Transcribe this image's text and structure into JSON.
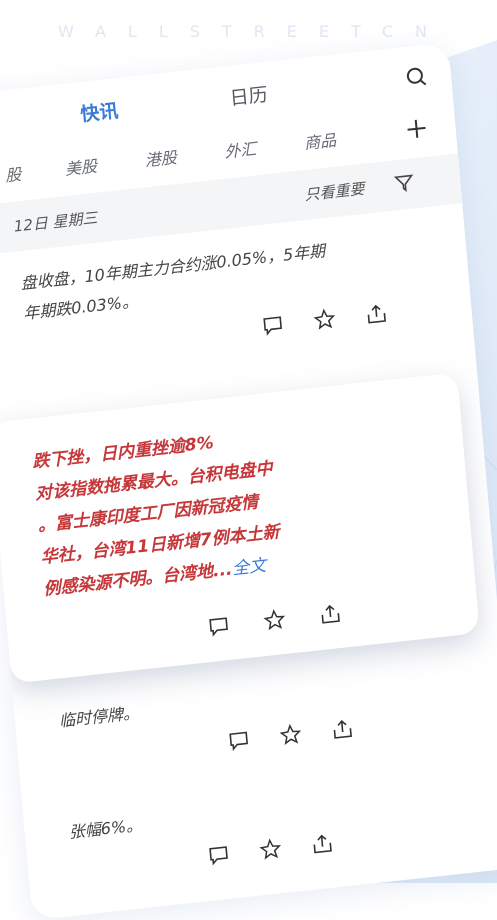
{
  "brand": "WALLSTREETCN",
  "tabs": {
    "news": "快讯",
    "calendar": "日历"
  },
  "categories": [
    "股",
    "美股",
    "港股",
    "外汇",
    "商品"
  ],
  "datebar": {
    "date": "12日 星期三",
    "filter": "只看重要"
  },
  "items": [
    {
      "lines": [
        "盘收盘，10年期主力合约涨0.05%，5年期",
        "年期跌0.03%。"
      ]
    },
    {
      "lines": [
        "临时停牌。"
      ]
    },
    {
      "lines": [
        "张幅6%。"
      ]
    }
  ],
  "card": {
    "lines": [
      "跌下挫，日内重挫逾8%",
      "对该指数拖累最大。台积电盘中",
      "。富士康印度工厂因新冠疫情",
      "华社，台湾11日新增7例本土新",
      "例感染源不明。台湾地..."
    ],
    "more": "全文"
  },
  "colors": {
    "accent": "#3a7bd5",
    "important": "#c6373a"
  }
}
